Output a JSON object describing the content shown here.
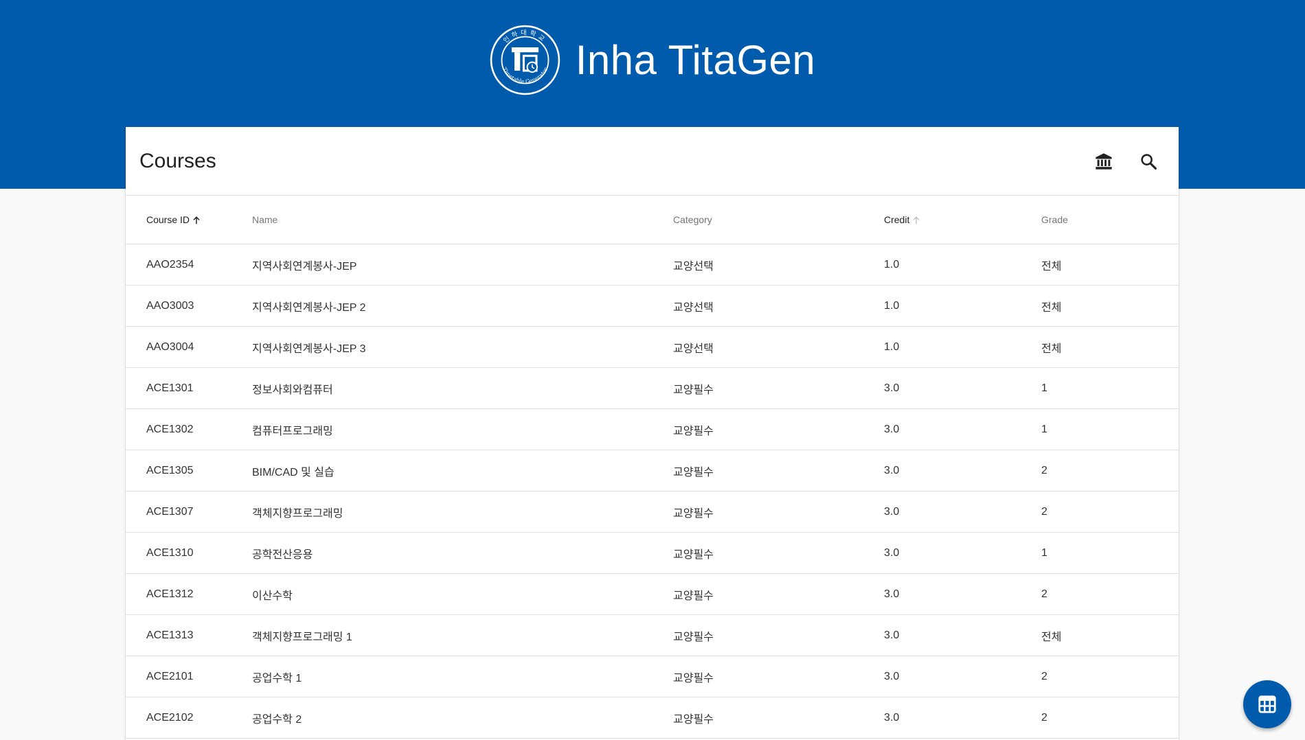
{
  "app": {
    "title": "Inha TitaGen",
    "logo": {
      "ring_text_top": "인하대학교",
      "ring_text_bottom": "Timetable Generator"
    },
    "accent_color": "#005bac"
  },
  "card": {
    "title": "Courses",
    "actions": [
      {
        "name": "university-button",
        "icon": "institution-icon"
      },
      {
        "name": "search-button",
        "icon": "search-icon"
      }
    ]
  },
  "table": {
    "columns": [
      {
        "label": "Course ID",
        "sort": "asc",
        "active": true
      },
      {
        "label": "Name"
      },
      {
        "label": "Category"
      },
      {
        "label": "Credit",
        "sort": "asc",
        "active": true
      },
      {
        "label": "Grade"
      }
    ],
    "rows": [
      [
        "AAO2354",
        "지역사회연계봉사-JEP",
        "교양선택",
        "1.0",
        "전체"
      ],
      [
        "AAO3003",
        "지역사회연계봉사-JEP 2",
        "교양선택",
        "1.0",
        "전체"
      ],
      [
        "AAO3004",
        "지역사회연계봉사-JEP 3",
        "교양선택",
        "1.0",
        "전체"
      ],
      [
        "ACE1301",
        "정보사회와컴퓨터",
        "교양필수",
        "3.0",
        "1"
      ],
      [
        "ACE1302",
        "컴퓨터프로그래밍",
        "교양필수",
        "3.0",
        "1"
      ],
      [
        "ACE1305",
        "BIM/CAD 및 실습",
        "교양필수",
        "3.0",
        "2"
      ],
      [
        "ACE1307",
        "객체지향프로그래밍",
        "교양필수",
        "3.0",
        "2"
      ],
      [
        "ACE1310",
        "공학전산응용",
        "교양필수",
        "3.0",
        "1"
      ],
      [
        "ACE1312",
        "이산수학",
        "교양필수",
        "3.0",
        "2"
      ],
      [
        "ACE1313",
        "객체지향프로그래밍 1",
        "교양필수",
        "3.0",
        "전체"
      ],
      [
        "ACE2101",
        "공업수학 1",
        "교양필수",
        "3.0",
        "2"
      ],
      [
        "ACE2102",
        "공업수학 2",
        "교양필수",
        "3.0",
        "2"
      ]
    ]
  },
  "fab": {
    "icon": "timetable-icon"
  }
}
